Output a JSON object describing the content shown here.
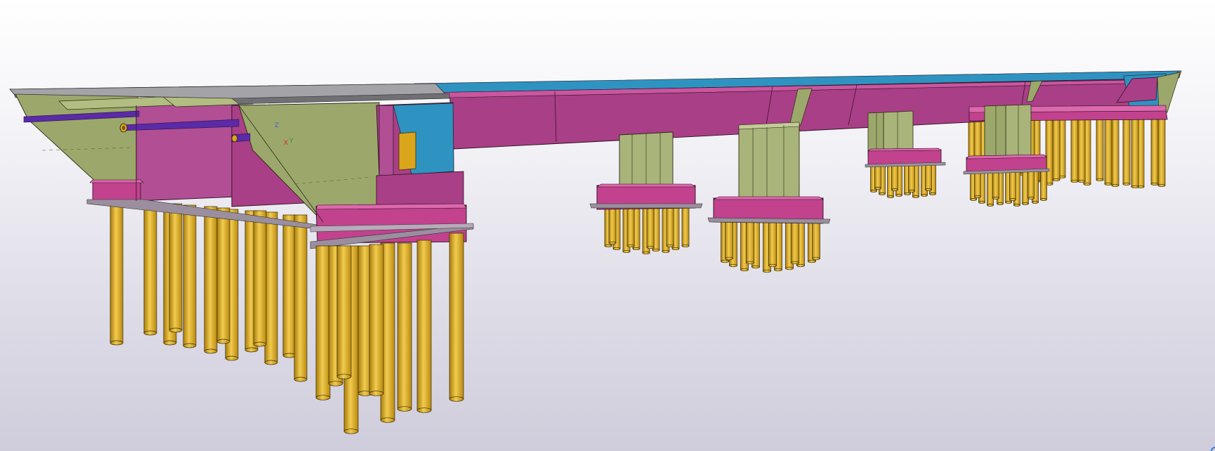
{
  "viewport": {
    "background_top": "#ffffff",
    "background_bottom": "#cfcddb"
  },
  "axes": {
    "z": "Z",
    "x": "X",
    "y": "Y"
  },
  "colors": {
    "pile": "#d9a51a",
    "pile_highlight": "#f1cb4f",
    "pile_shadow": "#a97d0c",
    "pile_cap": "#c2428e",
    "pile_cap_top": "#dd68ad",
    "pile_cap_side": "#9e2e73",
    "girder": "#a93f86",
    "girder_top": "#c9569f",
    "girder_blue": "#2f93c2",
    "deck_grey": "#a3a3a8",
    "deck_dark": "#6f6f74",
    "abutment_green": "#9ca86b",
    "abutment_green_light": "#b2bd81",
    "pier_green": "#a9b47b",
    "conduit_purple": "#5b2aa6",
    "axis_z": "#4a5adb",
    "axis_x": "#d42a2a",
    "axis_y": "#2b9a3a"
  },
  "model": {
    "piers_count": 4,
    "abutments_count": 2
  }
}
